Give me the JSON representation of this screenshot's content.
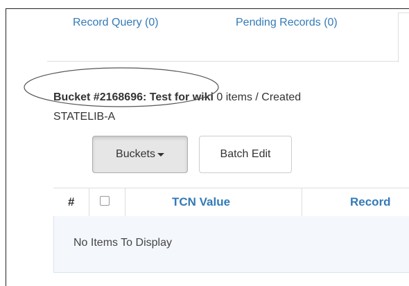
{
  "tabs": [
    {
      "label": "Record Query (0)"
    },
    {
      "label": "Pending Records (0)"
    }
  ],
  "bucket": {
    "title": "Bucket #2168696: Test for wiki",
    "meta": " 0 items / Created",
    "owner": "STATELIB-A"
  },
  "toolbar": {
    "buckets_label": "Buckets",
    "batch_edit_label": "Batch Edit"
  },
  "grid": {
    "columns": [
      "#",
      "TCN Value",
      "Record"
    ],
    "empty_message": "No Items To Display"
  },
  "colors": {
    "link": "#337ab7",
    "text": "#333333",
    "border": "#dddddd",
    "body_bg": "#f4f8fc",
    "annotation": "#555555"
  }
}
